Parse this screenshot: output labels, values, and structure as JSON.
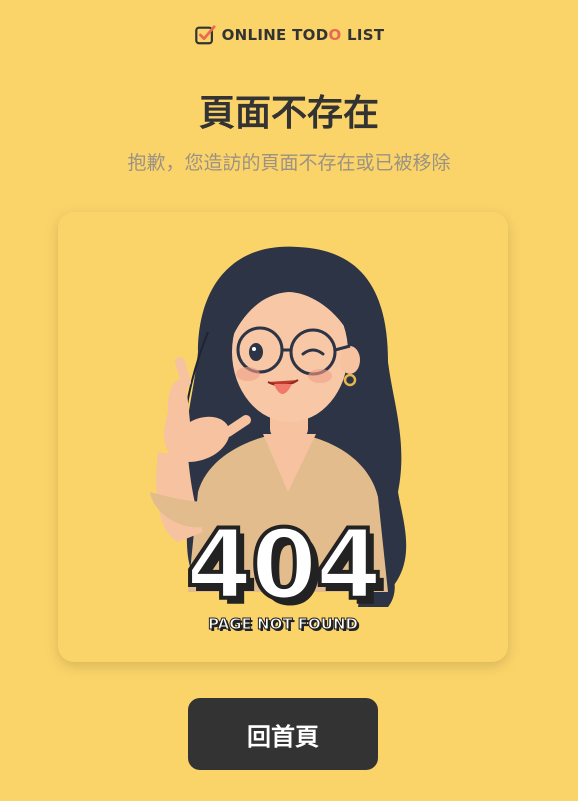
{
  "brand": {
    "text_before": "ONLINE TOD",
    "text_accent": "O",
    "text_after": " LIST",
    "icon": "checkbox-check-icon",
    "accent_color": "#E86A53"
  },
  "page": {
    "title": "頁面不存在",
    "subtitle": "抱歉，您造訪的頁面不存在或已被移除"
  },
  "illustration": {
    "code": "404",
    "caption": "PAGE NOT FOUND",
    "icon": "girl-wink-illustration"
  },
  "actions": {
    "home_label": "回首頁"
  },
  "colors": {
    "background": "#FBD469",
    "text": "#333333",
    "subtitle": "#9B9283",
    "button": "#333333"
  }
}
